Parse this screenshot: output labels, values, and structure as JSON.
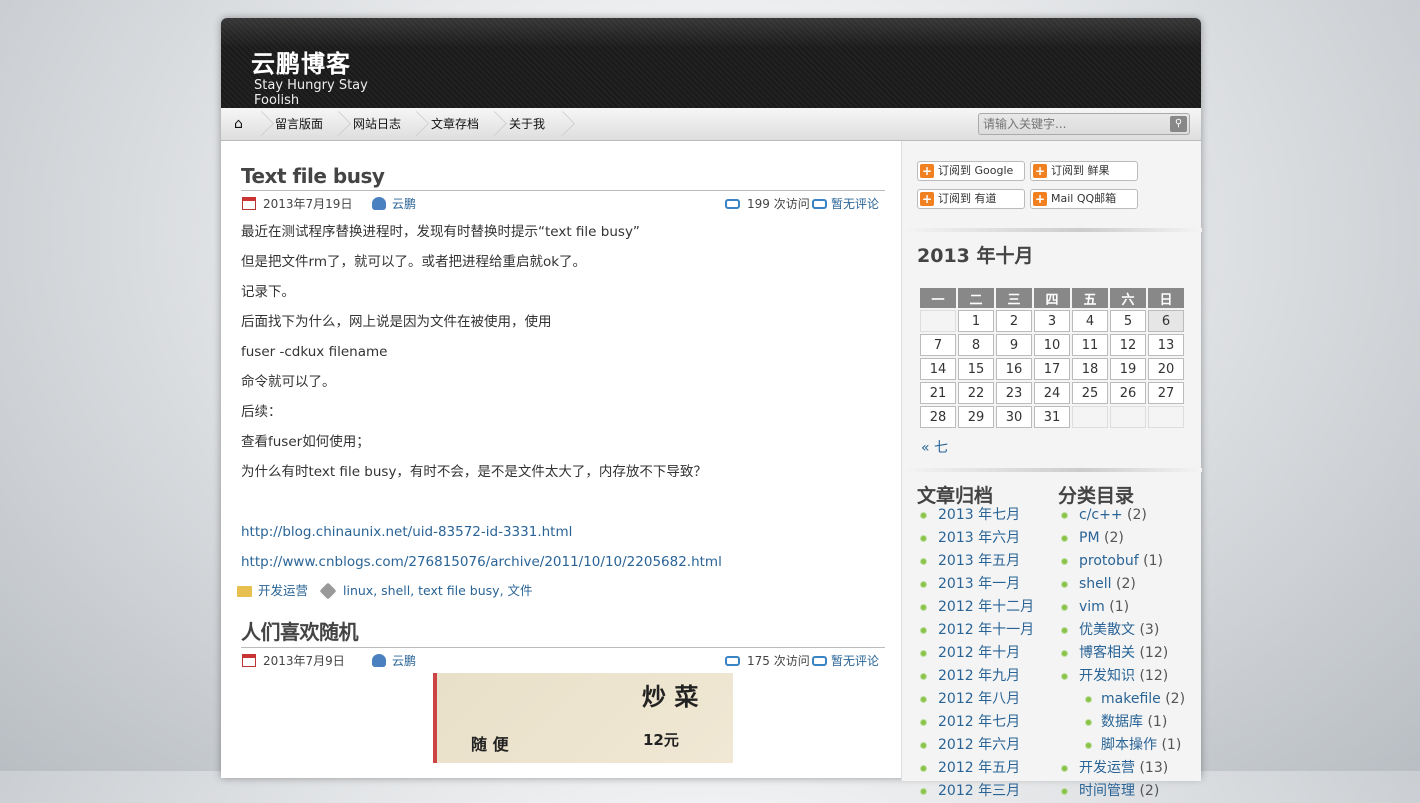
{
  "site": {
    "title": "云鹏博客",
    "description": "Stay Hungry Stay Foolish"
  },
  "nav": {
    "items": [
      "留言版面",
      "网站日志",
      "文章存档",
      "关于我"
    ],
    "search_placeholder": "请输入关键字..."
  },
  "posts": [
    {
      "title": "Text file busy",
      "date": "2013年7月19日",
      "author": "云鹏",
      "views": "199 次访问",
      "comments": "暂无评论",
      "body": [
        "最近在测试程序替换进程时，发现有时替换时提示“text file busy”",
        "但是把文件rm了，就可以了。或者把进程给重启就ok了。",
        "记录下。",
        "后面找下为什么，网上说是因为文件在被使用，使用",
        "fuser -cdkux filename",
        "命令就可以了。",
        "后续：",
        "查看fuser如何使用；",
        "为什么有时text file busy，有时不会，是不是文件太大了，内存放不下导致？"
      ],
      "links": [
        "http://blog.chinaunix.net/uid-83572-id-3331.html",
        "http://www.cnblogs.com/276815076/archive/2011/10/10/2205682.html"
      ],
      "category": "开发运营",
      "tags": "linux, shell, text file busy, 文件"
    },
    {
      "title": "人们喜欢随机",
      "date": "2013年7月9日",
      "author": "云鹏",
      "views": "175 次访问",
      "comments": "暂无评论",
      "image_text": {
        "a": "炒 菜",
        "b": "随 便",
        "c": "12元"
      }
    }
  ],
  "feeds": [
    "订阅到 Google",
    "订阅到 鲜果",
    "订阅到 有道",
    "Mail QQ邮箱"
  ],
  "calendar": {
    "caption": "2013 年十月",
    "weekdays": [
      "一",
      "二",
      "三",
      "四",
      "五",
      "六",
      "日"
    ],
    "weeks": [
      [
        "",
        "1",
        "2",
        "3",
        "4",
        "5",
        "6"
      ],
      [
        "7",
        "8",
        "9",
        "10",
        "11",
        "12",
        "13"
      ],
      [
        "14",
        "15",
        "16",
        "17",
        "18",
        "19",
        "20"
      ],
      [
        "21",
        "22",
        "23",
        "24",
        "25",
        "26",
        "27"
      ],
      [
        "28",
        "29",
        "30",
        "31",
        "",
        "",
        ""
      ]
    ],
    "today": "6",
    "prev": "« 七"
  },
  "archives": {
    "title": "文章归档",
    "items": [
      "2013 年七月",
      "2013 年六月",
      "2013 年五月",
      "2013 年一月",
      "2012 年十二月",
      "2012 年十一月",
      "2012 年十月",
      "2012 年九月",
      "2012 年八月",
      "2012 年七月",
      "2012 年六月",
      "2012 年五月",
      "2012 年三月"
    ]
  },
  "categories": {
    "title": "分类目录",
    "items": [
      {
        "name": "c/c++",
        "count": "(2)"
      },
      {
        "name": "PM",
        "count": "(2)"
      },
      {
        "name": "protobuf",
        "count": "(1)"
      },
      {
        "name": "shell",
        "count": "(2)"
      },
      {
        "name": "vim",
        "count": "(1)"
      },
      {
        "name": "优美散文",
        "count": "(3)"
      },
      {
        "name": "博客相关",
        "count": "(12)"
      },
      {
        "name": "开发知识",
        "count": "(12)"
      },
      {
        "name": "makefile",
        "count": "(2)",
        "sub": true
      },
      {
        "name": "数据库",
        "count": "(1)",
        "sub": true
      },
      {
        "name": "脚本操作",
        "count": "(1)",
        "sub": true
      },
      {
        "name": "开发运营",
        "count": "(13)"
      },
      {
        "name": "时间管理",
        "count": "(2)"
      }
    ]
  }
}
